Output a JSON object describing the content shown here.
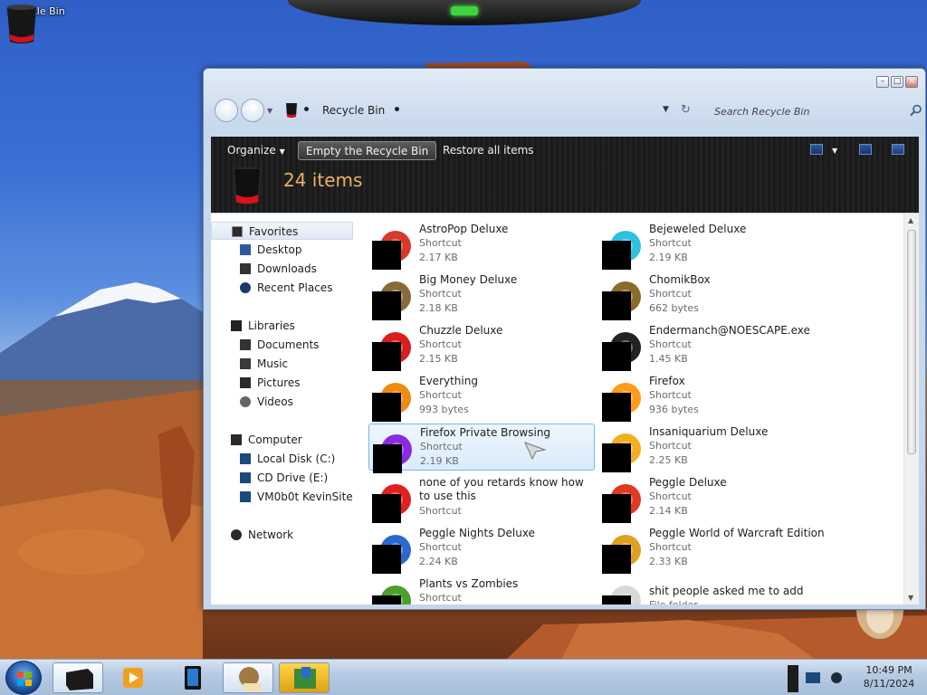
{
  "desktop": {
    "icons": [
      {
        "label": "Recycle Bin",
        "icon": "recycle-bin-icon"
      }
    ]
  },
  "window": {
    "address": {
      "location": "Recycle Bin"
    },
    "search": {
      "placeholder": "Search Recycle Bin"
    },
    "toolbar": {
      "organize": "Organize",
      "empty": "Empty the Recycle Bin",
      "restore": "Restore all items"
    },
    "header": {
      "count": "24 items"
    },
    "nav": {
      "favorites": "Favorites",
      "desktop": "Desktop",
      "downloads": "Downloads",
      "recent": "Recent Places",
      "libraries": "Libraries",
      "documents": "Documents",
      "music": "Music",
      "pictures": "Pictures",
      "videos": "Videos",
      "computer": "Computer",
      "local_disk": "Local Disk (C:)",
      "cd_drive": "CD Drive (E:)",
      "vm_site": "VM0b0t KevinSite",
      "network": "Network"
    },
    "files": [
      {
        "name": "AstroPop Deluxe",
        "type": "Shortcut",
        "size": "2.17 KB",
        "icon": "astropop-icon",
        "color": "#d63a2a"
      },
      {
        "name": "Bejeweled Deluxe",
        "type": "Shortcut",
        "size": "2.19 KB",
        "icon": "bejeweled-icon",
        "color": "#2fc0e0"
      },
      {
        "name": "Big Money Deluxe",
        "type": "Shortcut",
        "size": "2.18 KB",
        "icon": "money-bag-icon",
        "color": "#8a6a3a"
      },
      {
        "name": "ChomikBox",
        "type": "Shortcut",
        "size": "662 bytes",
        "icon": "chomikbox-icon",
        "color": "#8a6b2a"
      },
      {
        "name": "Chuzzle Deluxe",
        "type": "Shortcut",
        "size": "2.15 KB",
        "icon": "chuzzle-icon",
        "color": "#d81e1e"
      },
      {
        "name": "Endermanch@NOESCAPE.exe",
        "type": "Shortcut",
        "size": "1.45 KB",
        "icon": "console-icon",
        "color": "#222222"
      },
      {
        "name": "Everything",
        "type": "Shortcut",
        "size": "993 bytes",
        "icon": "everything-icon",
        "color": "#f08a10"
      },
      {
        "name": "Firefox",
        "type": "Shortcut",
        "size": "936 bytes",
        "icon": "firefox-icon",
        "color": "#ff9a1a"
      },
      {
        "name": "Firefox Private Browsing",
        "type": "Shortcut",
        "size": "2.19 KB",
        "icon": "firefox-private-icon",
        "color": "#8a2be2"
      },
      {
        "name": "Insaniquarium Deluxe",
        "type": "Shortcut",
        "size": "2.25 KB",
        "icon": "fish-icon",
        "color": "#f0b020"
      },
      {
        "name": "none of you retards know how to use this",
        "type": "Shortcut",
        "size": "",
        "icon": "shortcut-icon",
        "color": "#e02020"
      },
      {
        "name": "Peggle Deluxe",
        "type": "Shortcut",
        "size": "2.14 KB",
        "icon": "peggle-icon",
        "color": "#e03a20"
      },
      {
        "name": "Peggle Nights Deluxe",
        "type": "Shortcut",
        "size": "2.24 KB",
        "icon": "peggle-nights-icon",
        "color": "#2a6ad0"
      },
      {
        "name": "Peggle World of Warcraft Edition",
        "type": "Shortcut",
        "size": "2.33 KB",
        "icon": "peggle-wow-icon",
        "color": "#e0a020"
      },
      {
        "name": "Plants vs Zombies",
        "type": "Shortcut",
        "size": "",
        "icon": "plants-icon",
        "color": "#4aa02a"
      },
      {
        "name": "shit people asked me to add",
        "type": "File folder",
        "size": "",
        "icon": "folder-icon",
        "color": "#d8d8d8"
      }
    ]
  },
  "taskbar": {
    "clock": {
      "time": "10:49 PM",
      "date": "8/11/2024"
    }
  }
}
